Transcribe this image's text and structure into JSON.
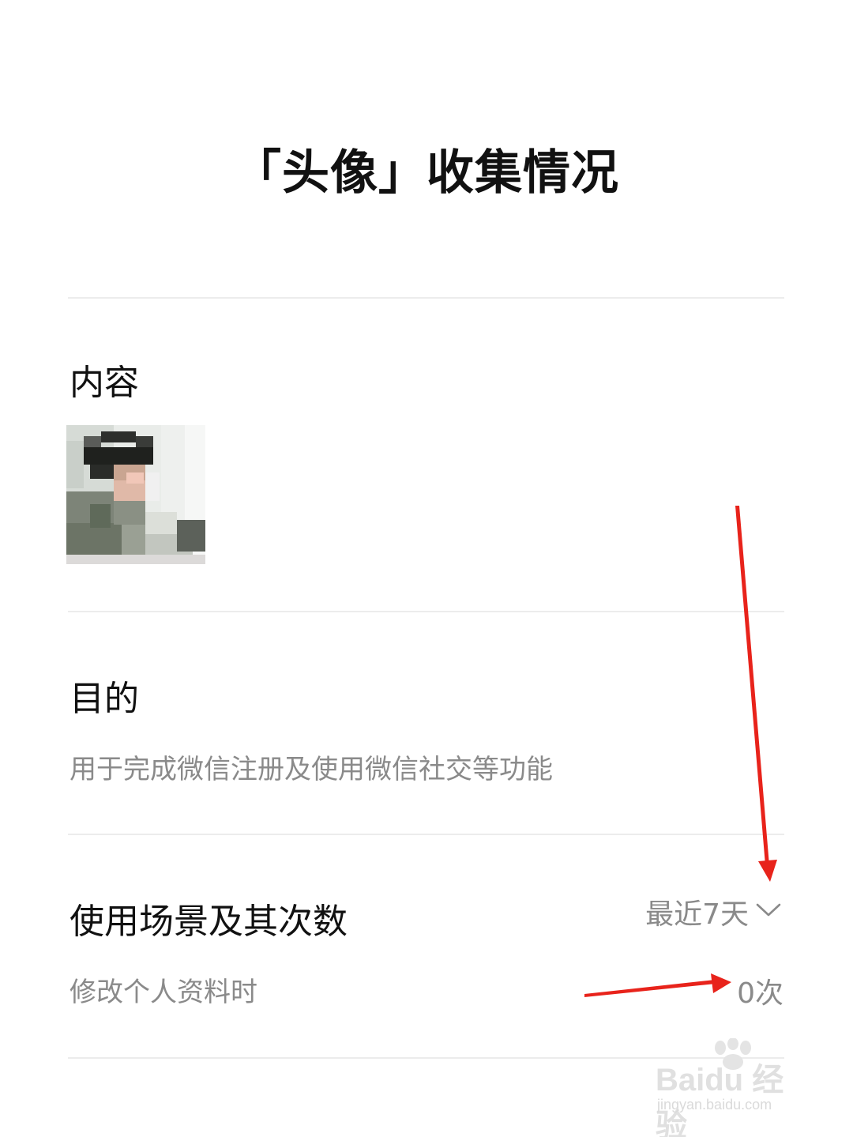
{
  "header": {
    "title": "「头像」收集情况"
  },
  "content_section": {
    "heading": "内容",
    "avatar_icon": "blurred-user-avatar"
  },
  "purpose_section": {
    "heading": "目的",
    "description": "用于完成微信注册及使用微信社交等功能"
  },
  "usage_section": {
    "heading": "使用场景及其次数",
    "range_label": "最近7天",
    "range_icon": "chevron-down-icon",
    "rows": [
      {
        "scene": "修改个人资料时",
        "count": "0次"
      }
    ]
  },
  "annotations": {
    "arrow_color": "#e8231b"
  },
  "watermark": {
    "brand": "Baidu 经验",
    "url": "jingyan.baidu.com"
  }
}
